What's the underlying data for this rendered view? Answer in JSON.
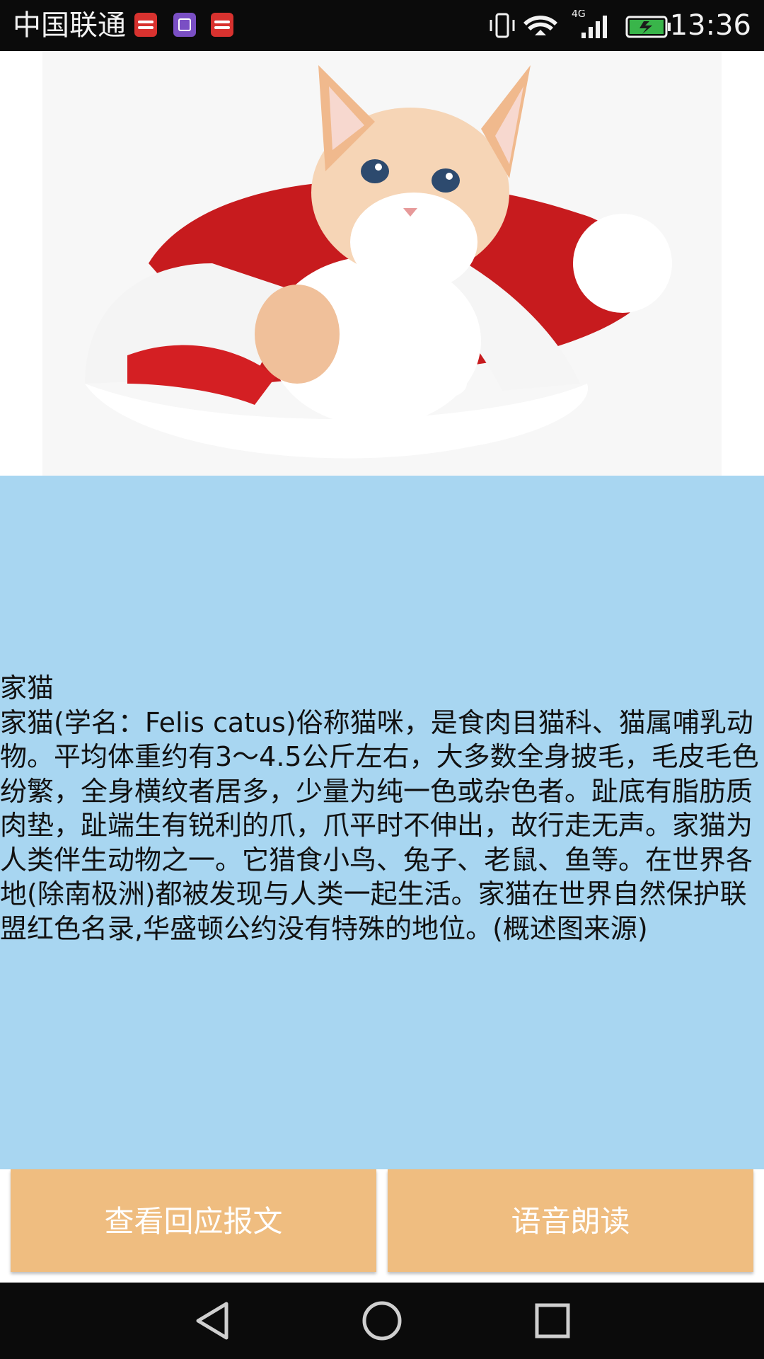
{
  "status_bar": {
    "carrier": "中国联通",
    "notification_icons": [
      "toutiao-icon",
      "gallery-icon",
      "toutiao-icon"
    ],
    "network": "4G",
    "time": "13:36"
  },
  "hero": {
    "image": "kitten-in-santa-hat"
  },
  "content": {
    "title": "家猫",
    "description": "家猫(学名：Felis catus)俗称猫咪，是食肉目猫科、猫属哺乳动物。平均体重约有3～4.5公斤左右，大多数全身披毛，毛皮毛色纷繁，全身横纹者居多，少量为纯一色或杂色者。趾底有脂肪质肉垫，趾端生有锐利的爪，爪平时不伸出，故行走无声。家猫为人类伴生动物之一。它猎食小鸟、兔子、老鼠、鱼等。在世界各地(除南极洲)都被发现与人类一起生活。家猫在世界自然保护联盟红色名录,华盛顿公约没有特殊的地位。(概述图来源)"
  },
  "actions": {
    "view_response_label": "查看回应报文",
    "read_aloud_label": "语音朗读"
  },
  "colors": {
    "panel_background": "#a8d6f1",
    "button_background": "#efbd80",
    "bar_background": "#0b0b0b"
  }
}
